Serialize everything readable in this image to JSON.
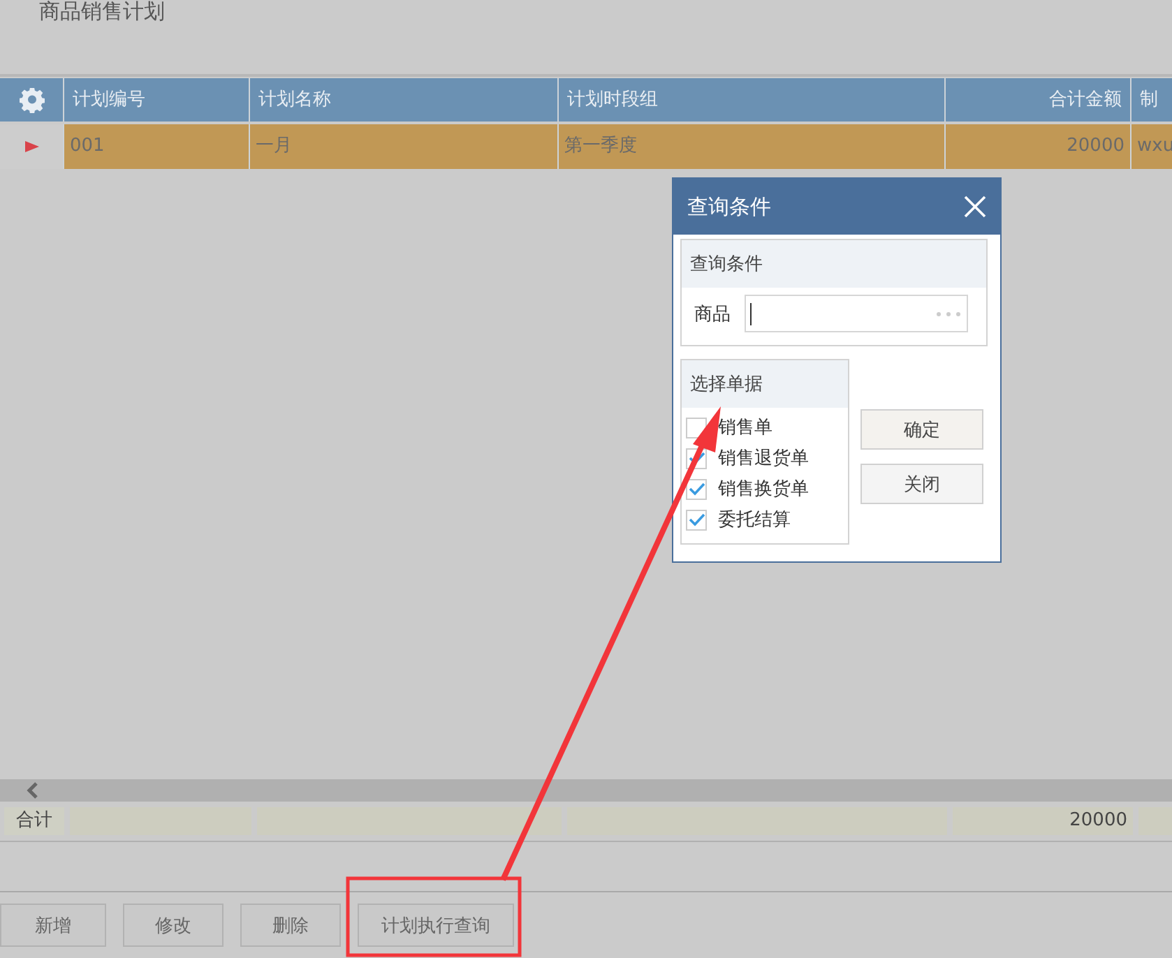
{
  "page_title": "商品销售计划",
  "table": {
    "columns": [
      "计划编号",
      "计划名称",
      "计划时段组",
      "合计金额",
      "制"
    ],
    "rows": [
      {
        "selected": true,
        "cells": [
          "001",
          "一月",
          "第一季度",
          "20000",
          "wxu"
        ]
      }
    ],
    "totals": {
      "label": "合计",
      "cells": [
        "",
        "",
        "",
        "20000",
        ""
      ]
    }
  },
  "dialog": {
    "title": "查询条件",
    "condition_group": {
      "title": "查询条件",
      "field_label": "商品"
    },
    "doc_group": {
      "title": "选择单据",
      "items": [
        {
          "label": "销售单",
          "checked": false
        },
        {
          "label": "销售退货单",
          "checked": true
        },
        {
          "label": "销售换货单",
          "checked": true
        },
        {
          "label": "委托结算",
          "checked": true
        }
      ]
    },
    "buttons": [
      "确定",
      "关闭"
    ]
  },
  "buttons": [
    "新增",
    "修改",
    "删除",
    "计划执行查询"
  ]
}
